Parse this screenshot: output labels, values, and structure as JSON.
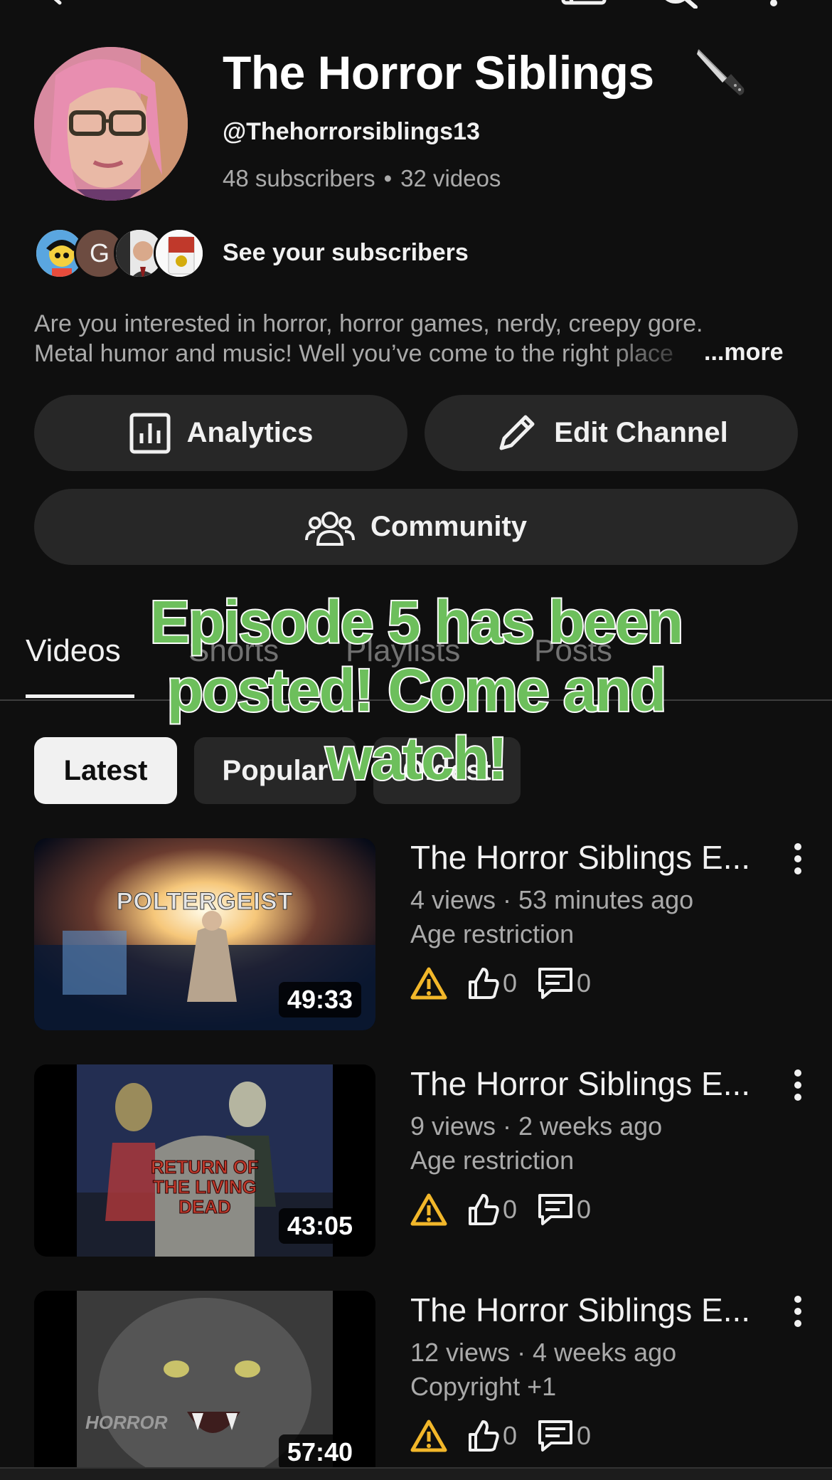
{
  "topbar": {
    "icons": [
      "back-icon",
      "cast-icon",
      "search-icon",
      "more-icon"
    ]
  },
  "channel": {
    "title": "The Horror Siblings",
    "title_emoji_icon": "knife-icon",
    "handle": "@Thehorrorsiblings13",
    "subscribers": "48 subscribers",
    "videos": "32 videos",
    "stats_separator": "•",
    "see_subscribers": "See your subscribers",
    "subscriber_avatar_letter": "G",
    "description_line1": "Are you interested in horror, horror games, nerdy, creepy gore.",
    "description_line2": "Metal humor and music! Well you’ve come to the right place",
    "more_label": "...more"
  },
  "buttons": {
    "analytics": "Analytics",
    "edit_channel": "Edit Channel",
    "community": "Community"
  },
  "tabs": [
    {
      "label": "Videos",
      "active": true
    },
    {
      "label": "Shorts",
      "active": false
    },
    {
      "label": "Playlists",
      "active": false
    },
    {
      "label": "Posts",
      "active": false
    }
  ],
  "filters": [
    {
      "label": "Latest",
      "selected": true
    },
    {
      "label": "Popular",
      "selected": false
    },
    {
      "label": "Oldest",
      "selected": false
    }
  ],
  "overlay_caption": "Episode 5 has been posted! Come and watch!",
  "videos": [
    {
      "title": "The Horror Siblings E...",
      "meta": "4 views · 53 minutes ago",
      "restriction": "Age restriction",
      "likes": "0",
      "comments": "0",
      "duration": "49:33",
      "thumb_text": "POLTERGEIST"
    },
    {
      "title": "The Horror Siblings E...",
      "meta": "9 views · 2 weeks ago",
      "restriction": "Age restriction",
      "likes": "0",
      "comments": "0",
      "duration": "43:05",
      "thumb_text": "RETURN OF THE LIVING DEAD"
    },
    {
      "title": "The Horror Siblings E...",
      "meta": "12 views · 4 weeks ago",
      "restriction": "Copyright +1",
      "likes": "0",
      "comments": "0",
      "duration": "57:40",
      "thumb_text": "HORROR"
    }
  ],
  "colors": {
    "background": "#0f0f0f",
    "button_bg": "#272727",
    "secondary_text": "#aaaaaa",
    "warning": "#f2b72a",
    "overlay_green": "#6dbf5c"
  }
}
